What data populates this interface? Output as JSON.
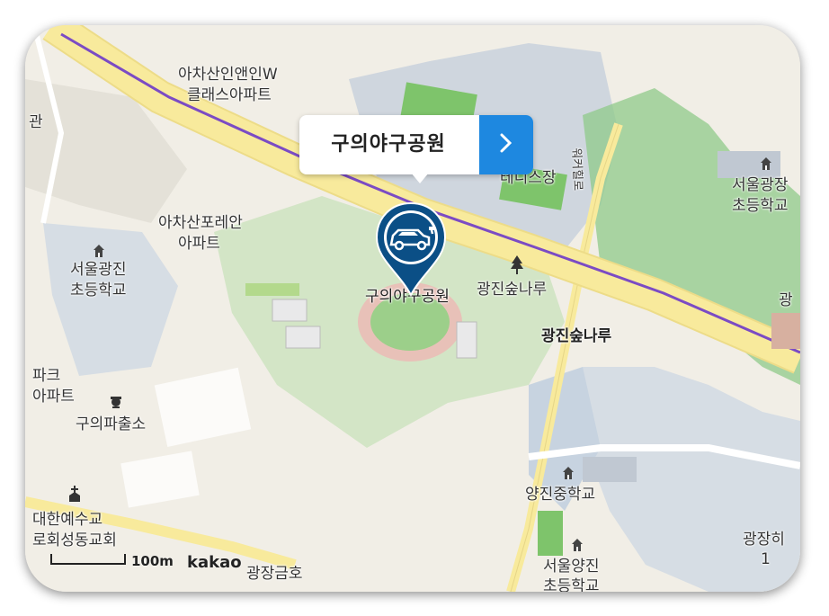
{
  "marker": {
    "place_name": "구의야구공원",
    "icon": "car-charging-icon"
  },
  "labels": {
    "achasan_w_1": "아차산인앤인W",
    "achasan_w_2": "클래스아파트",
    "tennis": "테니스장",
    "ballpark": "구의야구공원",
    "achasan_forest_1": "아차산포레안",
    "achasan_forest_2": "아파트",
    "seoul_gwangjin_school_1": "서울광진",
    "seoul_gwangjin_school_2": "초등학교",
    "park_apt_1": "파크",
    "park_apt_2": "아파트",
    "police_box": "구의파출소",
    "church_1": "대한예수교",
    "church_2": "로회성동교회",
    "forest_stop": "광진숲나루",
    "forest_station": "광진숲나루",
    "seoul_gwangjang_1": "서울광장",
    "seoul_gwangjang_2": "초등학교",
    "yangjin_middle": "양진중학교",
    "seoul_yangjin_1": "서울양진",
    "seoul_yangjin_2": "초등학교",
    "gwangjang_geumho": "광장금호",
    "gwangjang_cut": "광장히",
    "gwangjang_cut2": "1",
    "gwang_edge": "광",
    "left_edge": "관",
    "road_name": "워커힐로"
  },
  "scale": {
    "text": "100m"
  },
  "logo": {
    "text": "kakao"
  },
  "colors": {
    "land": "#f1eee6",
    "road_major": "#f8ea9c",
    "subway": "#7b4bc4",
    "park": "#d3e5c6",
    "green": "#8fc98a",
    "block": "#cfd6de",
    "accent": "#1e88e0",
    "marker": "#0b4f86"
  }
}
